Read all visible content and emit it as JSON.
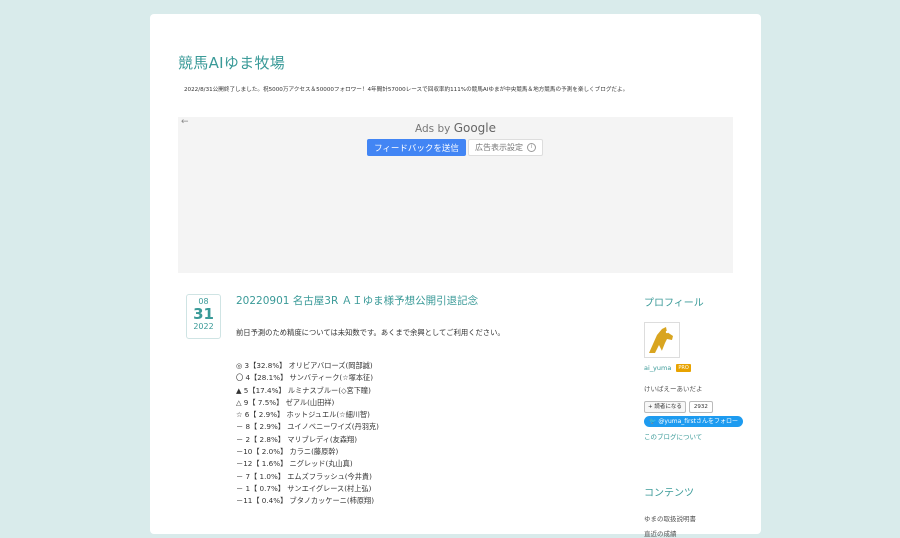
{
  "blog": {
    "title": "競馬AIゆま牧場",
    "description": "2022/8/31公開終了しました。祝5000万アクセス＆50000フォロワー！4年間計57000レースで回収率約111%の競馬AIゆまが中央競馬＆地方競馬の予測を楽しくブログだよ。"
  },
  "ad": {
    "back_icon": "←",
    "ads_by": "Ads by",
    "google": "Google",
    "feedback_label": "フィードバックを送信",
    "settings_label": "広告表示設定"
  },
  "entry": {
    "month": "08",
    "day": "31",
    "year": "2022",
    "title": "20220901 名古屋3R ＡＩゆま様予想公開引退記念",
    "lead": "前日予測のため精度については未知数です。あくまで余興としてご利用ください。",
    "predictions": [
      "◎ 3【32.8%】 オリビアバローズ(岡部誠)",
      "〇 4【28.1%】 サンバティーク(☆塚本征)",
      "▲ 5【17.4%】 ルミナスブルー(◇宮下瞳)",
      "△ 9【 7.5%】 ゼアル(山田祥)",
      "☆ 6【 2.9%】 ホットジュエル(☆細川智)",
      "－ 8【 2.9%】 ユイノベニーワイズ(丹羽克)",
      "－ 2【 2.8%】 マリブレディ(友森翔)",
      "－10【 2.0%】 カラニ(藤原幹)",
      "－12【 1.6%】 ニグレッド(丸山真)",
      "－ 7【 1.0%】 エムズフラッシュ(今井貴)",
      "－ 1【 0.7%】 サンエイグレース(村上弘)",
      "－11【 0.4%】 ブタノカッケーニ(柿原翔)"
    ]
  },
  "sidebar": {
    "profile_heading": "プロフィール",
    "profile_name": "ai_yuma",
    "pro_badge": "PRO",
    "profile_sub": "けいばえーあいだよ",
    "reader_button": "読者になる",
    "reader_count": "2932",
    "twitter_button": "@yuma_firstさんをフォロー",
    "about_link": "このブログについて",
    "contents_heading": "コンテンツ",
    "contents_links": [
      "ゆまの取扱説明書",
      "直近の成績"
    ]
  },
  "colors": {
    "accent": "#3a9a98",
    "background": "#d9ebeb",
    "google_blue": "#4285f4",
    "twitter_blue": "#1d9bf0",
    "pro_orange": "#e8a300",
    "logo_gold": "#d9a520"
  }
}
